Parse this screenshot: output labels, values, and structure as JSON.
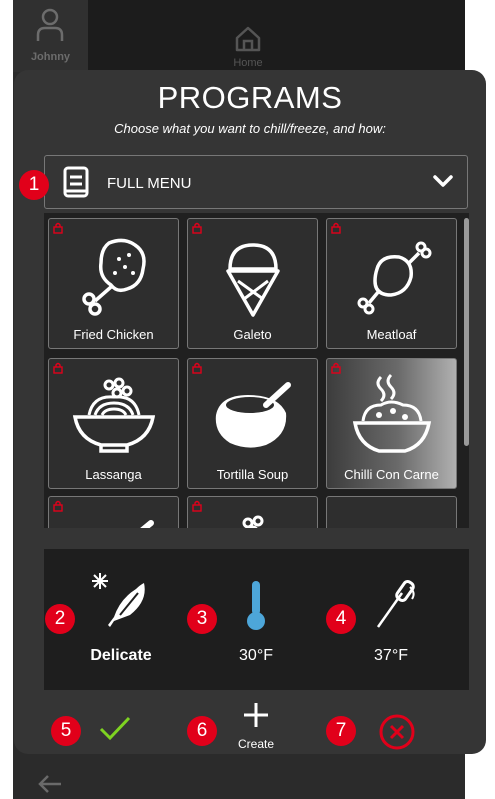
{
  "topbar": {
    "user_label": "Johnny",
    "home_label": "Home"
  },
  "panel": {
    "title": "PROGRAMS",
    "subtitle": "Choose what you want to chill/freeze, and how:"
  },
  "dropdown": {
    "selected": "FULL MENU",
    "icon": "menu-book-icon"
  },
  "programs": [
    {
      "label": "Fried Chicken",
      "icon": "fried-chicken-icon",
      "locked": true
    },
    {
      "label": "Galeto",
      "icon": "ice-cream-cone-icon",
      "locked": true
    },
    {
      "label": "Meatloaf",
      "icon": "meat-icon",
      "locked": true
    },
    {
      "label": "Lassanga",
      "icon": "pasta-bowl-icon",
      "locked": true
    },
    {
      "label": "Tortilla Soup",
      "icon": "soup-bowl-icon",
      "locked": true
    },
    {
      "label": "Chilli Con Carne",
      "icon": "steaming-bowl-icon",
      "locked": true,
      "selected": true
    }
  ],
  "settings": {
    "mode": {
      "label": "Delicate",
      "icon": "feather-snowflake-icon"
    },
    "temperature": {
      "value": "30°F",
      "icon": "thermometer-icon"
    },
    "probe": {
      "value": "37°F",
      "icon": "probe-icon"
    }
  },
  "actions": {
    "create_label": "Create"
  },
  "badges": [
    "1",
    "2",
    "3",
    "4",
    "5",
    "6",
    "7"
  ],
  "colors": {
    "badge": "#e1001a",
    "confirm": "#7ed321",
    "cancel": "#e1001a",
    "lock": "#e1001a"
  }
}
